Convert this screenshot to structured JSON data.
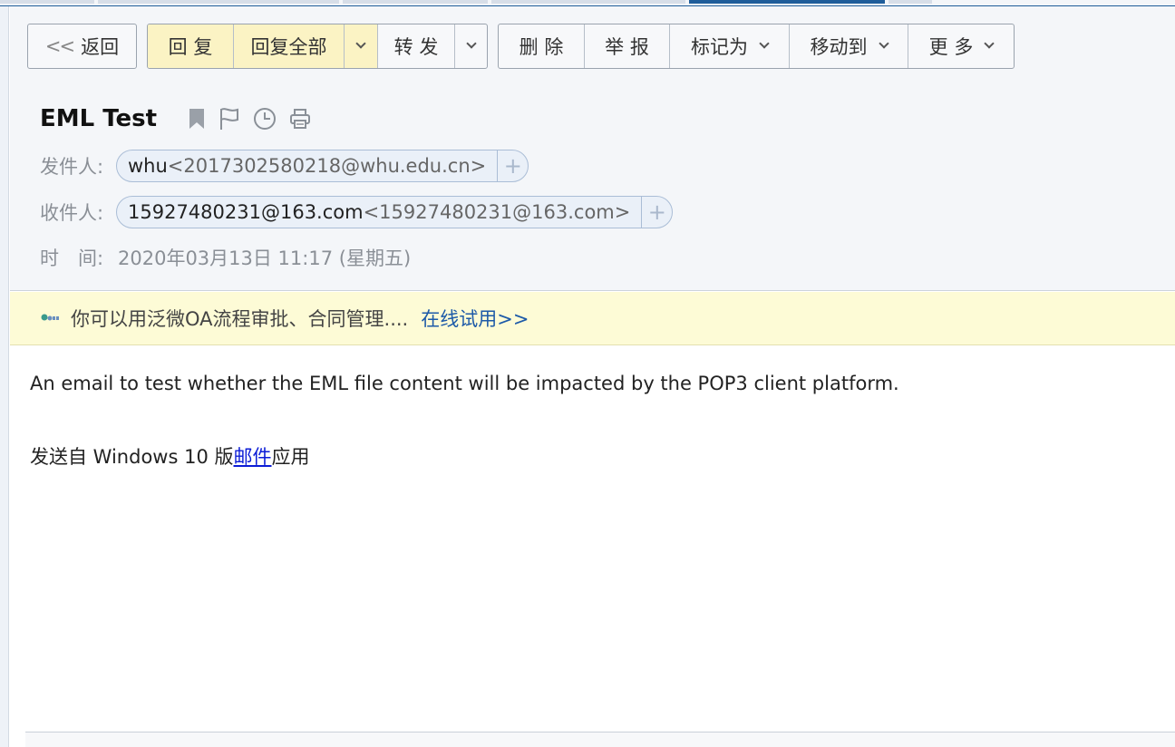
{
  "toolbar": {
    "back_label": "返回",
    "reply_label": "回 复",
    "reply_all_label": "回复全部",
    "forward_label": "转 发",
    "delete_label": "删 除",
    "report_label": "举 报",
    "mark_as_label": "标记为",
    "move_to_label": "移动到",
    "more_label": "更 多"
  },
  "email": {
    "subject": "EML Test",
    "sender_label": "发件人:",
    "sender_name": "whu",
    "sender_address": "<2017302580218@whu.edu.cn>",
    "recipient_label": "收件人:",
    "recipient_name": "15927480231@163.com",
    "recipient_address": "<15927480231@163.com>",
    "time_label": "时　间:",
    "time_value": "2020年03月13日 11:17 (星期五)",
    "body_line1": "An email to test whether the EML file content will be impacted by the POP3 client platform.",
    "signature_prefix": "发送自 Windows 10 版",
    "signature_link": "邮件",
    "signature_suffix": "应用"
  },
  "promo": {
    "text": "你可以用泛微OA流程审批、合同管理....",
    "link": "在线试用>>"
  },
  "icons": {
    "plus_glyph": "+",
    "back_glyph": "<<"
  },
  "colors": {
    "reply_highlight": "#fbf3c4",
    "promo_bg": "#fdfbd6",
    "link_blue": "#1d5aa8",
    "mail_link": "#0b1cd6",
    "accent": "#1f5d9a"
  }
}
